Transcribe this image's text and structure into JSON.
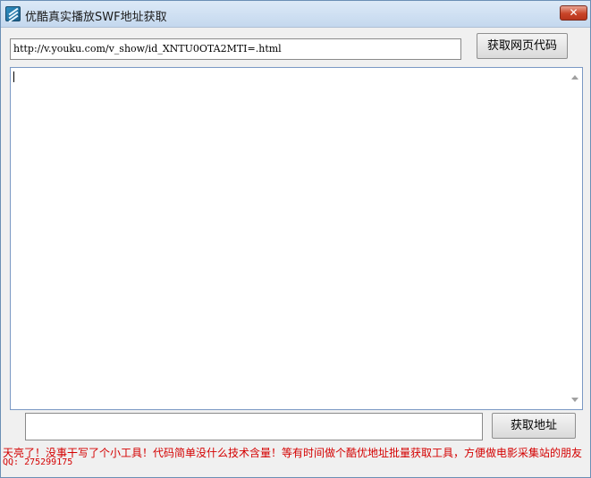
{
  "window": {
    "title": "优酷真实播放SWF地址获取",
    "close_symbol": "✕"
  },
  "url_field": {
    "value": "http://v.youku.com/v_show/id_XNTU0OTA2MTI=.html"
  },
  "buttons": {
    "fetch_page_code": "获取网页代码",
    "get_address": "获取地址"
  },
  "output_area": {
    "value": ""
  },
  "address_field": {
    "value": ""
  },
  "footer": {
    "message": "天亮了！没事干写了个小工具！代码简单没什么技术含量！等有时间做个酷优地址批量获取工具，方便做电影采集站的朋友",
    "qq": "QQ: 275299175"
  },
  "colors": {
    "footer_text": "#d40000",
    "title_bar": "#c4d8ee",
    "close_button": "#c84428"
  },
  "icons": [
    "app-icon",
    "close-icon",
    "scroll-up-arrow-icon",
    "scroll-down-arrow-icon"
  ]
}
